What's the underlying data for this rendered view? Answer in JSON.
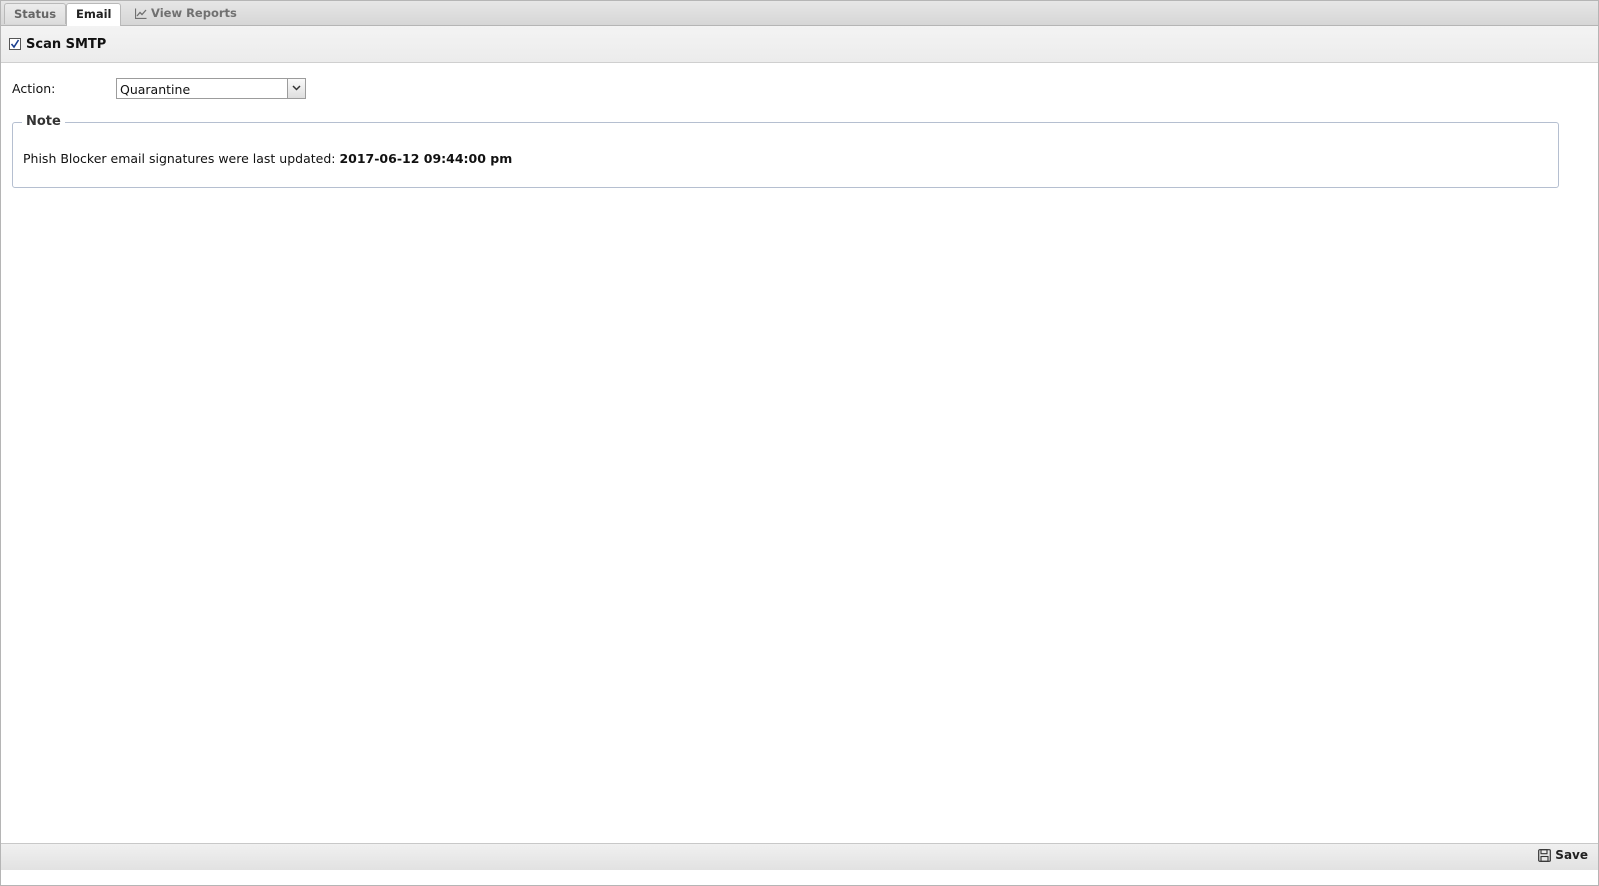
{
  "tabs": [
    {
      "label": "Status",
      "active": false
    },
    {
      "label": "Email",
      "active": true
    },
    {
      "label": "View Reports",
      "active": false,
      "icon": "chart-line-icon"
    }
  ],
  "scan": {
    "label": "Scan SMTP",
    "checked": true
  },
  "action": {
    "label": "Action:",
    "value": "Quarantine"
  },
  "note": {
    "legend": "Note",
    "text": "Phish Blocker email signatures were last updated: ",
    "timestamp": "2017-06-12 09:44:00 pm"
  },
  "toolbar": {
    "save_label": "Save",
    "save_icon": "floppy-disk-icon"
  }
}
